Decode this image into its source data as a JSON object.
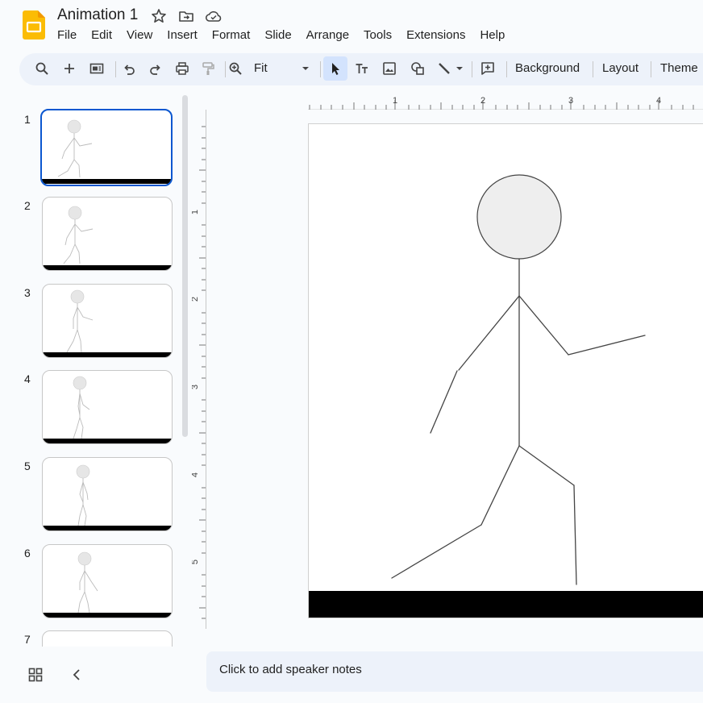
{
  "app": {
    "title": "Animation 1",
    "logo_icon": "slides-logo-icon",
    "header_icons": [
      "star-icon",
      "move-to-folder-icon",
      "cloud-saved-icon"
    ]
  },
  "menu": [
    "File",
    "Edit",
    "View",
    "Insert",
    "Format",
    "Slide",
    "Arrange",
    "Tools",
    "Extensions",
    "Help"
  ],
  "toolbar": {
    "zoom_label": "Fit",
    "background_label": "Background",
    "layout_label": "Layout",
    "theme_label": "Theme",
    "icons": [
      "search-icon",
      "new-slide-icon",
      "slide-layout-icon",
      "undo-icon",
      "redo-icon",
      "print-icon",
      "paint-format-icon",
      "zoom-icon",
      "dropdown-arrow-icon",
      "select-arrow-icon",
      "text-box-icon",
      "image-icon",
      "shape-icon",
      "line-icon",
      "line-dropdown-icon",
      "comment-icon"
    ]
  },
  "filmstrip": {
    "slides": [
      {
        "number": "1",
        "active": true
      },
      {
        "number": "2",
        "active": false
      },
      {
        "number": "3",
        "active": false
      },
      {
        "number": "4",
        "active": false
      },
      {
        "number": "5",
        "active": false
      },
      {
        "number": "6",
        "active": false
      },
      {
        "number": "7",
        "active": false
      }
    ]
  },
  "rulers": {
    "horizontal": [
      "1",
      "2",
      "3",
      "4"
    ],
    "vertical": [
      "1",
      "2",
      "3",
      "4",
      "5"
    ]
  },
  "notes": {
    "placeholder": "Click to add speaker notes"
  },
  "colors": {
    "accent": "#0b57d0",
    "toolbar_bg": "#edf2fa",
    "selected_tool_bg": "#d3e3fd",
    "head_fill": "#eeeeee",
    "ground": "#000000"
  },
  "bottom_bar_icons": [
    "grid-view-icon",
    "collapse-panel-icon"
  ]
}
